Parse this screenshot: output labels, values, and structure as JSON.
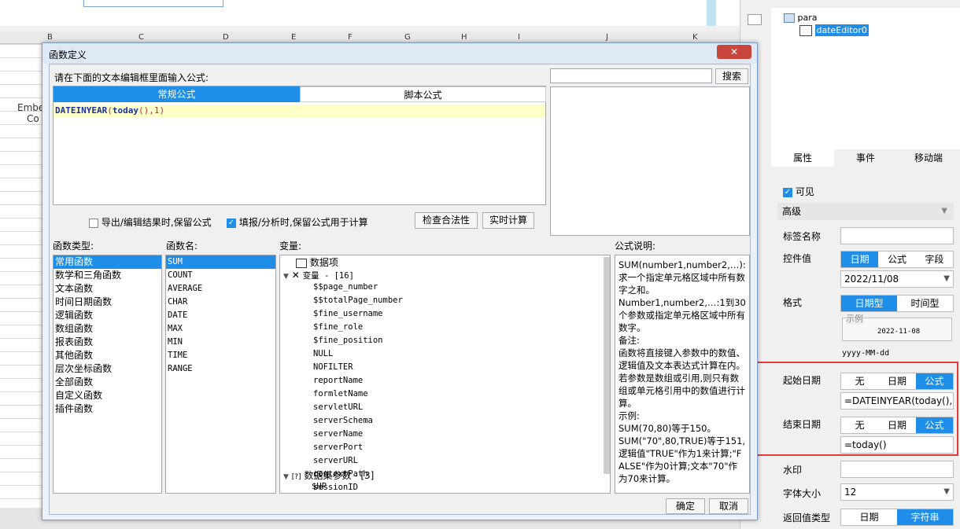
{
  "background": {
    "columns": [
      "B",
      "C",
      "D",
      "E",
      "F",
      "G",
      "H",
      "I",
      "J",
      "K"
    ],
    "embed_text_1": "Embe",
    "embed_text_2": "Co"
  },
  "right_panel": {
    "tree_root": "para",
    "tree_child": "dateEditor0",
    "tabs": [
      "属性",
      "事件",
      "移动端"
    ],
    "visible_label": "可见",
    "advanced_label": "高级",
    "label_name": "标签名称",
    "control_value": "控件值",
    "control_value_opts": [
      "日期",
      "公式",
      "字段"
    ],
    "date_value": "2022/11/08",
    "format_label": "格式",
    "format_opts": [
      "日期型",
      "时间型"
    ],
    "example_label": "示例",
    "example_value": "2022-11-08",
    "format_pattern": "yyyy-MM-dd",
    "start_date_label": "起始日期",
    "start_opts": [
      "无",
      "日期",
      "公式"
    ],
    "start_formula": "=DATEINYEAR(today(),1)",
    "end_date_label": "结束日期",
    "end_opts": [
      "无",
      "日期",
      "公式"
    ],
    "end_formula": "=today()",
    "watermark_label": "水印",
    "font_size_label": "字体大小",
    "font_size_value": "12",
    "return_type_label": "返回值类型",
    "return_opts": [
      "日期",
      "字符串"
    ]
  },
  "dialog": {
    "title": "函数定义",
    "close": "✕",
    "instruction": "请在下面的文本编辑框里面输入公式:",
    "tab_regular": "常规公式",
    "tab_script": "脚本公式",
    "formula_func": "DATEINYEAR",
    "formula_paren": "(",
    "formula_arg": "today",
    "formula_rest": "(),1)",
    "search_button": "搜索",
    "opt_export": "导出/编辑结果时,保留公式",
    "opt_fill": "填报/分析时,保留公式用于计算",
    "check_button": "检查合法性",
    "realtime_button": "实时计算",
    "type_header": "函数类型:",
    "name_header": "函数名:",
    "var_header": "变量:",
    "desc_header": "公式说明:",
    "types": [
      "常用函数",
      "数学和三角函数",
      "文本函数",
      "时间日期函数",
      "逻辑函数",
      "数组函数",
      "报表函数",
      "其他函数",
      "层次坐标函数",
      "全部函数",
      "自定义函数",
      "插件函数"
    ],
    "names": [
      "SUM",
      "COUNT",
      "AVERAGE",
      "CHAR",
      "DATE",
      "MAX",
      "MIN",
      "TIME",
      "RANGE"
    ],
    "var_dataitem": "数据项",
    "var_group": "变量 - [16]",
    "variables": [
      "$$page_number",
      "$$totalPage_number",
      "$fine_username",
      "$fine_role",
      "$fine_position",
      "NULL",
      "NOFILTER",
      "reportName",
      "formletName",
      "servletURL",
      "serverSchema",
      "serverName",
      "serverPort",
      "serverURL",
      "contextPath",
      "sessionID"
    ],
    "dataset_group": "数据集参数 - [3]",
    "dataset_first": "$HP",
    "desc_lines": [
      "SUM(number1,number2,…):求一个指定单元格区域中所有数字之和。",
      "Number1,number2,…:1到30个参数或指定单元格区域中所有数字。",
      "备注:",
      "函数将直接键入参数中的数值、逻辑值及文本表达式计算在内。若参数是数组或引用,则只有数组或单元格引用中的数值进行计算。",
      "示例:",
      "SUM(70,80)等于150。",
      "SUM(\"70\",80,TRUE)等于151,逻辑值\"TRUE\"作为1来计算;\"FALSE\"作为0计算;文本\"70\"作为70来计算。"
    ],
    "ok_button": "确定",
    "cancel_button": "取消"
  }
}
